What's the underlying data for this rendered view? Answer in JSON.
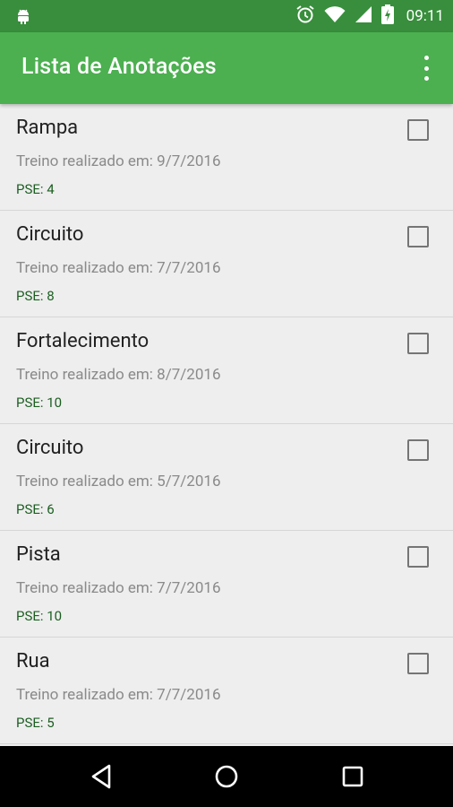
{
  "status_bar": {
    "time": "09:11",
    "icons": [
      "android-icon",
      "alarm-icon",
      "wifi-icon",
      "signal-icon",
      "battery-charging-icon"
    ]
  },
  "app_bar": {
    "title": "Lista de Anotações",
    "menu_icon": "overflow-menu-icon"
  },
  "items": [
    {
      "name": "Rampa",
      "date": "Treino realizado em: 9/7/2016",
      "pse": "PSE: 4",
      "checked": false
    },
    {
      "name": "Circuito",
      "date": "Treino realizado em: 7/7/2016",
      "pse": "PSE: 8",
      "checked": false
    },
    {
      "name": "Fortalecimento",
      "date": "Treino realizado em: 8/7/2016",
      "pse": "PSE: 10",
      "checked": false
    },
    {
      "name": "Circuito",
      "date": "Treino realizado em: 5/7/2016",
      "pse": "PSE: 6",
      "checked": false
    },
    {
      "name": "Pista",
      "date": "Treino realizado em: 7/7/2016",
      "pse": "PSE: 10",
      "checked": false
    },
    {
      "name": "Rua",
      "date": "Treino realizado em: 7/7/2016",
      "pse": "PSE: 5",
      "checked": false
    }
  ],
  "nav_bar": {
    "buttons": [
      "back-icon",
      "home-icon",
      "recents-icon"
    ]
  },
  "colors": {
    "status_bar": "#388e3c",
    "app_bar": "#4caf50",
    "pse_text": "#1b5e20",
    "background": "#eeeeee"
  }
}
